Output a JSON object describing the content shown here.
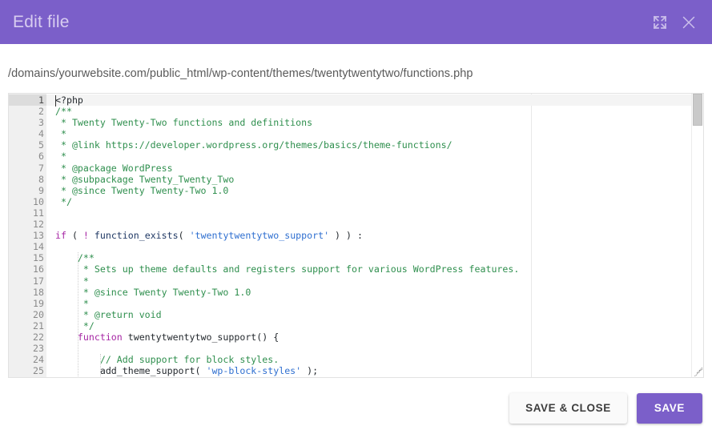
{
  "header": {
    "title": "Edit file",
    "expand_icon": "expand-icon",
    "close_icon": "close-icon"
  },
  "file_path": "/domains/yourwebsite.com/public_html/wp-content/themes/twentytwentytwo/functions.php",
  "editor": {
    "active_line": 1,
    "fold_lines": [
      2,
      15,
      22
    ],
    "lines": [
      {
        "n": 1,
        "tokens": [
          {
            "t": "plain",
            "s": "<?php"
          }
        ]
      },
      {
        "n": 2,
        "tokens": [
          {
            "t": "comment",
            "s": "/**"
          }
        ]
      },
      {
        "n": 3,
        "tokens": [
          {
            "t": "comment",
            "s": " * Twenty Twenty-Two functions and definitions"
          }
        ]
      },
      {
        "n": 4,
        "tokens": [
          {
            "t": "comment",
            "s": " *"
          }
        ]
      },
      {
        "n": 5,
        "tokens": [
          {
            "t": "comment",
            "s": " * @link https://developer.wordpress.org/themes/basics/theme-functions/"
          }
        ]
      },
      {
        "n": 6,
        "tokens": [
          {
            "t": "comment",
            "s": " *"
          }
        ]
      },
      {
        "n": 7,
        "tokens": [
          {
            "t": "comment",
            "s": " * @package WordPress"
          }
        ]
      },
      {
        "n": 8,
        "tokens": [
          {
            "t": "comment",
            "s": " * @subpackage Twenty_Twenty_Two"
          }
        ]
      },
      {
        "n": 9,
        "tokens": [
          {
            "t": "comment",
            "s": " * @since Twenty Twenty-Two 1.0"
          }
        ]
      },
      {
        "n": 10,
        "tokens": [
          {
            "t": "comment",
            "s": " */"
          }
        ]
      },
      {
        "n": 11,
        "tokens": [
          {
            "t": "plain",
            "s": ""
          }
        ]
      },
      {
        "n": 12,
        "tokens": [
          {
            "t": "plain",
            "s": ""
          }
        ]
      },
      {
        "n": 13,
        "tokens": [
          {
            "t": "kw",
            "s": "if"
          },
          {
            "t": "plain",
            "s": " ( "
          },
          {
            "t": "kw",
            "s": "!"
          },
          {
            "t": "plain",
            "s": " "
          },
          {
            "t": "fn",
            "s": "function_exists"
          },
          {
            "t": "plain",
            "s": "( "
          },
          {
            "t": "str",
            "s": "'twentytwentytwo_support'"
          },
          {
            "t": "plain",
            "s": " ) ) :"
          }
        ]
      },
      {
        "n": 14,
        "tokens": [
          {
            "t": "plain",
            "s": ""
          }
        ]
      },
      {
        "n": 15,
        "tokens": [
          {
            "t": "comment",
            "s": "    /**"
          }
        ]
      },
      {
        "n": 16,
        "tokens": [
          {
            "t": "comment",
            "s": "     * Sets up theme defaults and registers support for various WordPress features."
          }
        ]
      },
      {
        "n": 17,
        "tokens": [
          {
            "t": "comment",
            "s": "     *"
          }
        ]
      },
      {
        "n": 18,
        "tokens": [
          {
            "t": "comment",
            "s": "     * @since Twenty Twenty-Two 1.0"
          }
        ]
      },
      {
        "n": 19,
        "tokens": [
          {
            "t": "comment",
            "s": "     *"
          }
        ]
      },
      {
        "n": 20,
        "tokens": [
          {
            "t": "comment",
            "s": "     * @return void"
          }
        ]
      },
      {
        "n": 21,
        "tokens": [
          {
            "t": "comment",
            "s": "     */"
          }
        ]
      },
      {
        "n": 22,
        "tokens": [
          {
            "t": "plain",
            "s": "    "
          },
          {
            "t": "kw",
            "s": "function"
          },
          {
            "t": "plain",
            "s": " twentytwentytwo_support() {"
          }
        ]
      },
      {
        "n": 23,
        "tokens": [
          {
            "t": "plain",
            "s": ""
          }
        ]
      },
      {
        "n": 24,
        "tokens": [
          {
            "t": "comment",
            "s": "        // Add support for block styles."
          }
        ]
      },
      {
        "n": 25,
        "tokens": [
          {
            "t": "plain",
            "s": "        add_theme_support( "
          },
          {
            "t": "str",
            "s": "'wp-block-styles'"
          },
          {
            "t": "plain",
            "s": " );"
          }
        ]
      }
    ]
  },
  "footer": {
    "save_and_close_label": "SAVE & CLOSE",
    "save_label": "SAVE"
  },
  "colors": {
    "brand_purple": "#7b5fc9",
    "title_text": "#d8cdf0",
    "comment_green": "#2f8f4e",
    "keyword_magenta": "#a626a4",
    "string_blue": "#2f6fd0",
    "function_navy": "#1f3864",
    "gutter_bg": "#f0f0f0",
    "path_text": "#5a5a5a"
  }
}
